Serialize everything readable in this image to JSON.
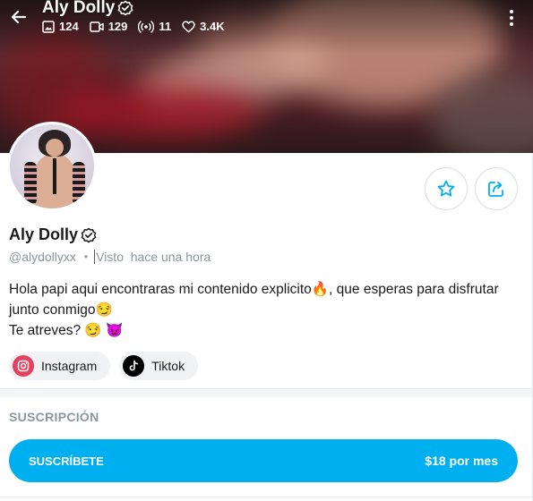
{
  "header": {
    "title": "Aly Dolly",
    "stats": [
      {
        "icon": "image-icon",
        "value": "124"
      },
      {
        "icon": "video-icon",
        "value": "129"
      },
      {
        "icon": "broadcast-icon",
        "value": "11"
      },
      {
        "icon": "heart-icon",
        "value": "3.4K"
      }
    ]
  },
  "profile": {
    "name": "Aly Dolly",
    "handle": "@alydollyxx",
    "separator": "•",
    "last_seen": "Visto  hace una hora",
    "bio_lines": [
      "Hola papi aqui encontraras mi contenido explicito🔥, que esperas para disfrutar",
      "junto conmigo😏",
      "Te atreves? 😏 😈"
    ]
  },
  "socials": [
    {
      "label": "Instagram",
      "icon": "instagram-icon"
    },
    {
      "label": "Tiktok",
      "icon": "tiktok-icon"
    }
  ],
  "subscription": {
    "section_title": "SUSCRIPCIÓN",
    "button_label": "SUSCRÍBETE",
    "price": "$18 por mes"
  },
  "colors": {
    "accent": "#00aff0",
    "muted": "#8a96a3",
    "instagram": "#e4405f"
  }
}
